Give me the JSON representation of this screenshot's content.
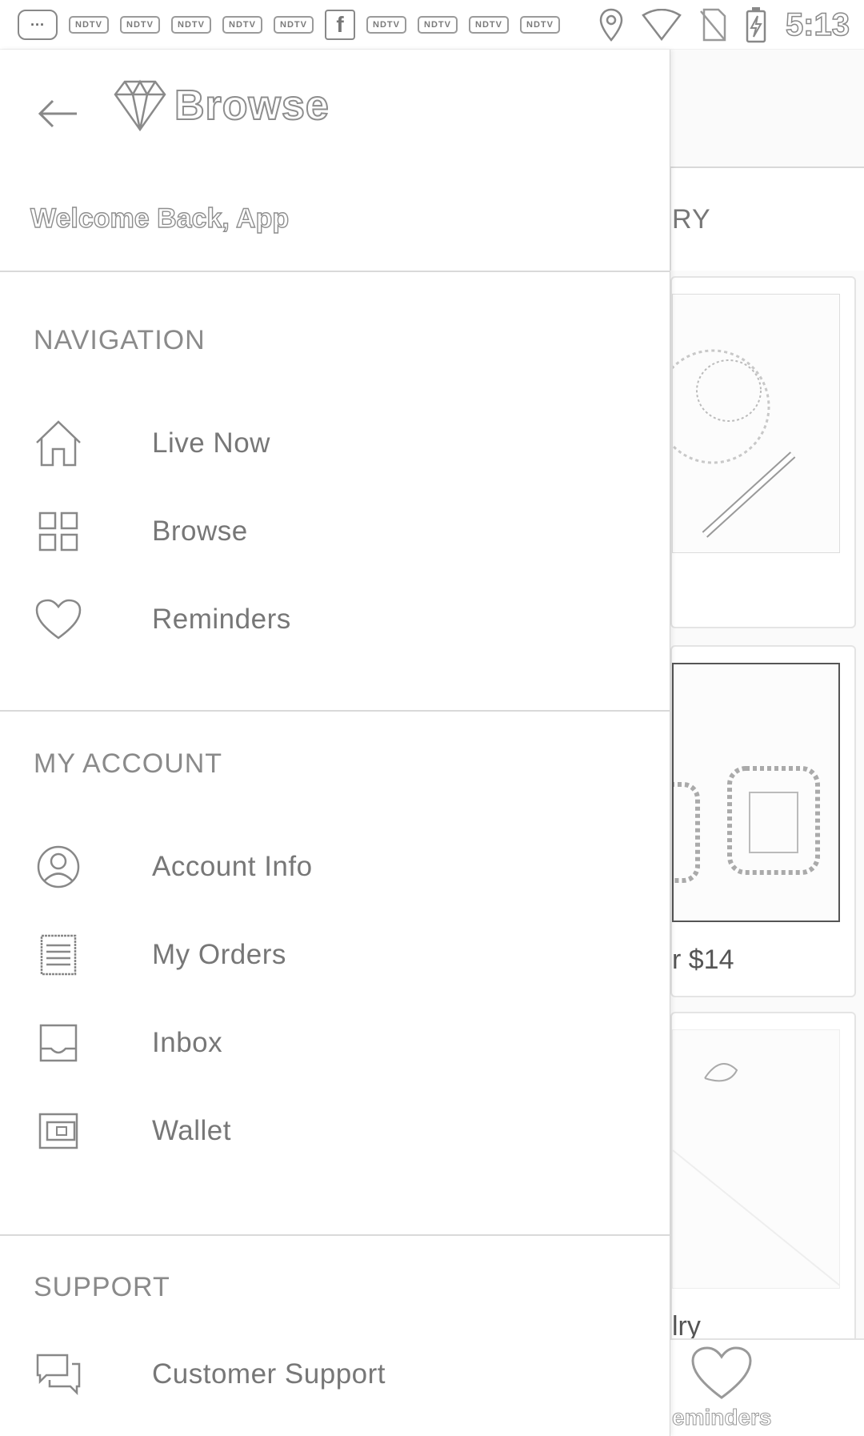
{
  "status_bar": {
    "notification_badges": [
      "NDTV",
      "NDTV",
      "NDTV",
      "NDTV",
      "NDTV",
      "NDTV",
      "NDTV",
      "NDTV",
      "NDTV"
    ],
    "time": "5:13"
  },
  "header": {
    "title": "Browse"
  },
  "welcome_text": "Welcome Back, App",
  "sections": {
    "navigation": {
      "title": "NAVIGATION",
      "items": [
        {
          "label": "Live Now",
          "icon": "home-icon"
        },
        {
          "label": "Browse",
          "icon": "grid-icon"
        },
        {
          "label": "Reminders",
          "icon": "heart-icon"
        }
      ]
    },
    "my_account": {
      "title": "MY ACCOUNT",
      "items": [
        {
          "label": "Account Info",
          "icon": "user-circle-icon"
        },
        {
          "label": "My Orders",
          "icon": "receipt-icon"
        },
        {
          "label": "Inbox",
          "icon": "inbox-icon"
        },
        {
          "label": "Wallet",
          "icon": "wallet-icon"
        }
      ]
    },
    "support": {
      "title": "SUPPORT",
      "items": [
        {
          "label": "Customer Support",
          "icon": "chat-icon"
        }
      ]
    }
  },
  "background": {
    "tab_fragment": "RY",
    "card2_price_fragment": "r $14",
    "card3_title_fragment": "lry",
    "bottom_tab_fragment": "eminders"
  }
}
